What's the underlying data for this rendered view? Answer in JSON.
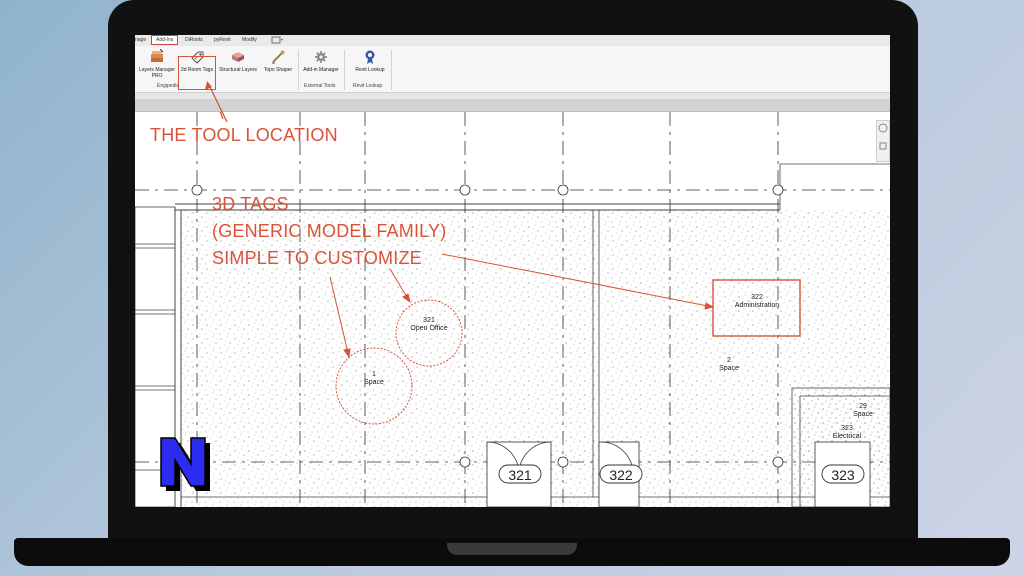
{
  "ribbon": {
    "tabs": [
      {
        "label": "nage"
      },
      {
        "label": "Add-Ins"
      },
      {
        "label": "DiRoots"
      },
      {
        "label": "pyRevit"
      },
      {
        "label": "Modify"
      }
    ],
    "tools": [
      {
        "label": "Layers Manager PRO",
        "icon": "layers-manager-icon"
      },
      {
        "label": "3d Room Tags",
        "icon": "room-tags-icon"
      },
      {
        "label": "Structural Layers",
        "icon": "structural-layers-icon"
      },
      {
        "label": "Topo Shaper",
        "icon": "topo-shaper-icon"
      },
      {
        "label": "Add-in Manager",
        "icon": "addin-manager-icon"
      },
      {
        "label": "Revit Lookup",
        "icon": "revit-lookup-icon"
      }
    ],
    "panels": [
      {
        "label": "Engipedia"
      },
      {
        "label": "External Tools"
      },
      {
        "label": "Revit Lookup"
      }
    ]
  },
  "annotations": {
    "tool_location": "THE TOOL LOCATION",
    "tags_line1": "3D TAGS",
    "tags_line2": "(GENERIC MODEL FAMILY)",
    "tags_line3": "SIMPLE TO CUSTOMIZE"
  },
  "room_tags": [
    {
      "number": "321",
      "name": "Open Office"
    },
    {
      "number": "1",
      "name": "Space"
    },
    {
      "number": "322",
      "name": "Administration"
    },
    {
      "number": "2",
      "name": "Space"
    },
    {
      "number": "29",
      "name": "Space"
    },
    {
      "number": "323",
      "name": "Electrical"
    }
  ],
  "door_tags": [
    {
      "number": "321"
    },
    {
      "number": "322"
    },
    {
      "number": "323"
    }
  ],
  "colors": {
    "accent": "#d9533a",
    "logo_fill": "#2c2cf0"
  }
}
